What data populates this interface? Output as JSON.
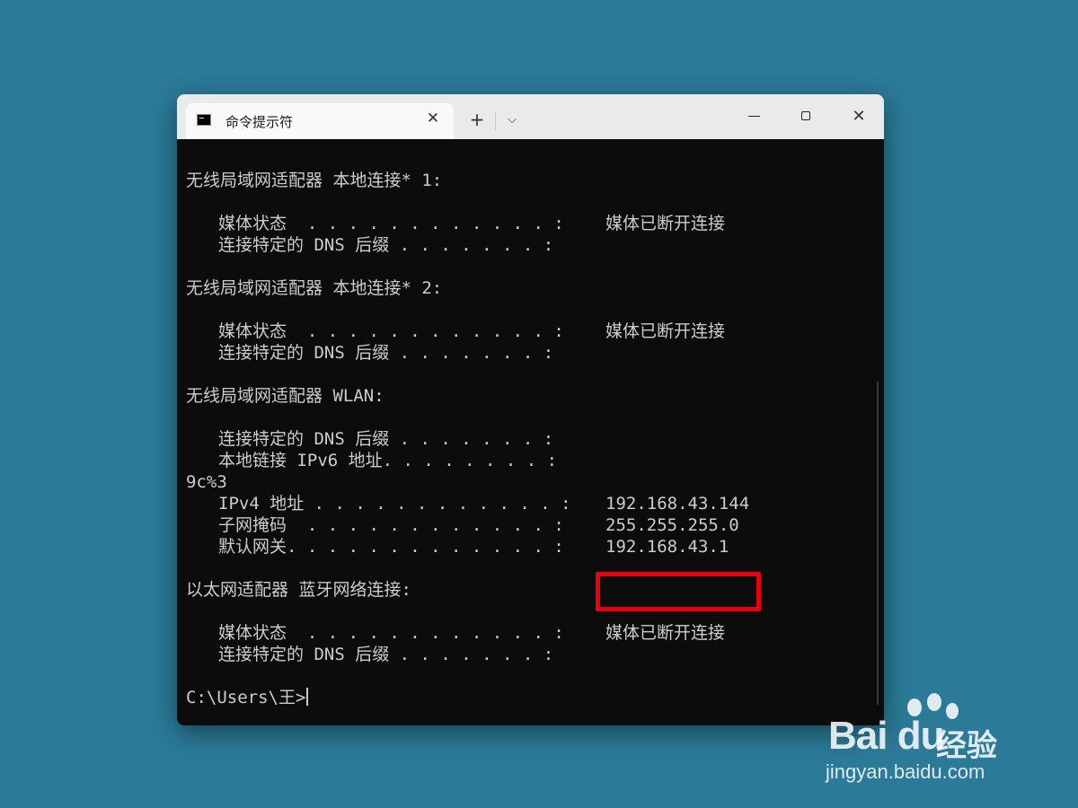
{
  "window": {
    "tab_title": "命令提示符",
    "tab_close": "✕",
    "new_tab": "+",
    "dropdown": "⌵",
    "close_glyph": "✕"
  },
  "console": {
    "lines": [
      "无线局域网适配器 本地连接* 1:",
      "媒体状态  . . . . . . . . . . . . :",
      "媒体已断开连接",
      "连接特定的 DNS 后缀 . . . . . . . :",
      "无线局域网适配器 本地连接* 2:",
      "媒体状态  . . . . . . . . . . . . :",
      "媒体已断开连接",
      "连接特定的 DNS 后缀 . . . . . . . :",
      "无线局域网适配器 WLAN:",
      "连接特定的 DNS 后缀 . . . . . . . :",
      "本地链接 IPv6 地址. . . . . . . . :",
      "9c%3",
      "IPv4 地址 . . . . . . . . . . . . :",
      "192.168.43.144",
      "子网掩码  . . . . . . . . . . . . :",
      "255.255.255.0",
      "默认网关. . . . . . . . . . . . . :",
      "192.168.43.1",
      "以太网适配器 蓝牙网络连接:",
      "媒体状态  . . . . . . . . . . . . :",
      "媒体已断开连接",
      "连接特定的 DNS 后缀 . . . . . . . :",
      "C:\\Users\\王>"
    ],
    "highlight_color": "#e8000f"
  },
  "watermark": {
    "logo": "Bai du",
    "brand": "经验",
    "url": "jingyan.baidu.com"
  }
}
